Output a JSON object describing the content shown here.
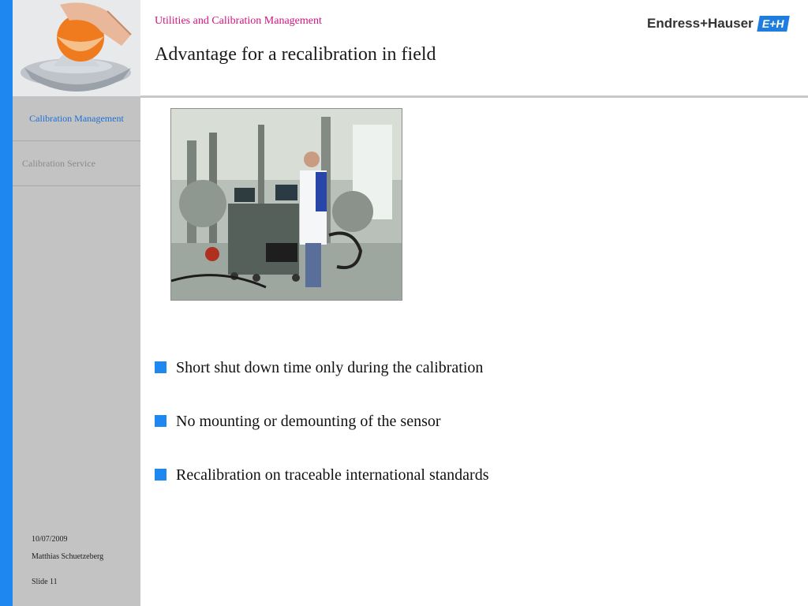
{
  "header": {
    "subtitle": "Utilities and Calibration Management",
    "title": "Advantage for a recalibration in field",
    "brand": "Endress+Hauser",
    "brand_mark": "E+H"
  },
  "sidebar": {
    "items": [
      {
        "label": "Calibration Management",
        "active": true
      },
      {
        "label": "Calibration Service",
        "active": false
      }
    ]
  },
  "footer": {
    "date": "10/07/2009",
    "author": "Matthias Schuetzeberg",
    "slide": "Slide 11"
  },
  "bullets": [
    "Short shut down time only during the calibration",
    "No mounting or demounting of the sensor",
    "Recalibration on traceable international standards"
  ],
  "colors": {
    "accent_blue": "#1e88f0",
    "subtitle_magenta": "#d0157d",
    "sidebar_gray": "#c3c3c3"
  },
  "icons": {
    "bullet": "blue-square",
    "logo_photo": "orange-juicer-photo",
    "content_photo": "field-calibration-lab-photo"
  }
}
